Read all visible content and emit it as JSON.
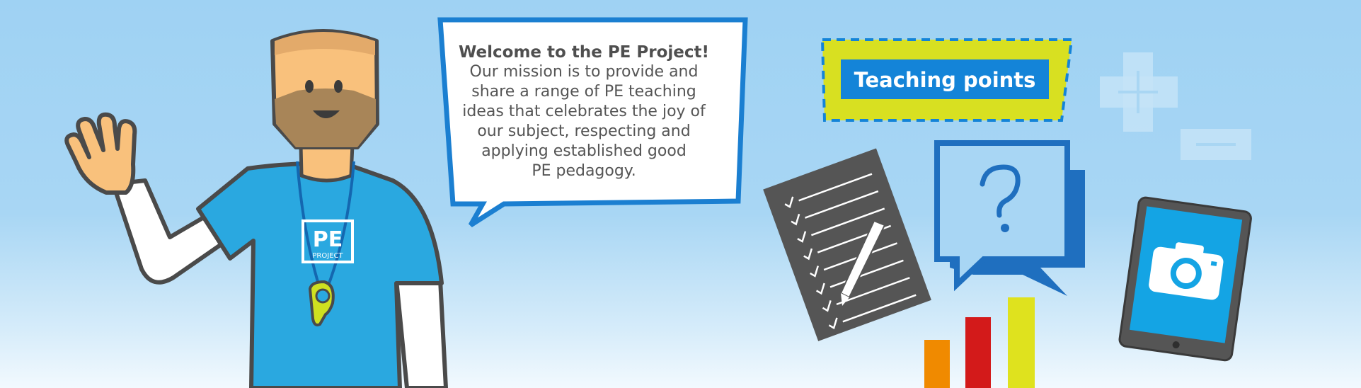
{
  "speech_bubble": {
    "title": "Welcome to the PE Project!",
    "lines": [
      "Our mission is to provide and",
      "share a range of PE teaching",
      "ideas that celebrates the joy of",
      "our subject, respecting and",
      "applying established good",
      "PE pedagogy."
    ]
  },
  "teaching_points": {
    "label": "Teaching points"
  },
  "colors": {
    "sky": "#a8d6f4",
    "shirt": "#2aa8e0",
    "bubble_border": "#1b7fd1",
    "teaching_points_bg": "#d8e021",
    "teaching_points_label_bg": "#1484d8",
    "bar_orange": "#f08a00",
    "bar_red": "#d31a1a",
    "bar_yellow": "#dfe21e"
  },
  "icons": [
    "presenter-character",
    "whistle-icon",
    "checklist-icon",
    "pen-icon",
    "question-bubble-icon",
    "plus-icon",
    "minus-icon",
    "tablet-camera-icon",
    "bar-chart-icon"
  ]
}
